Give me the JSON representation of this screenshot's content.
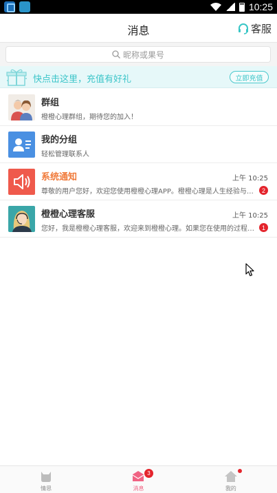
{
  "status_bar": {
    "time": "10:25"
  },
  "header": {
    "title": "消息",
    "service_label": "客服"
  },
  "search": {
    "placeholder": "昵称或果号"
  },
  "banner": {
    "text": "快点击这里，充值有好礼",
    "button_label": "立即充值"
  },
  "list": [
    {
      "title": "群组",
      "subtitle": "橙橙心理群组，期待您的加入！",
      "time": "",
      "badge": ""
    },
    {
      "title": "我的分组",
      "subtitle": "轻松管理联系人",
      "time": "",
      "badge": ""
    },
    {
      "title": "系统通知",
      "subtitle": "尊敬的用户您好，欢迎您使用橙橙心理APP。橙橙心理是人生经验与…",
      "time": "上午 10:25",
      "badge": "2"
    },
    {
      "title": "橙橙心理客服",
      "subtitle": "您好，我是橙橙心理客服，欢迎来到橙橙心理。如果您在使用的过程…",
      "time": "上午 10:25",
      "badge": "1"
    }
  ],
  "bottom_nav": {
    "items": [
      {
        "label": "情思",
        "icon": "cat-icon"
      },
      {
        "label": "消息",
        "icon": "envelope-icon",
        "badge": "3"
      },
      {
        "label": "我的",
        "icon": "house-icon"
      }
    ]
  },
  "colors": {
    "accent": "#3cc5c9",
    "notice": "#f07a3a",
    "active_tab": "#f06383",
    "badge": "#e4242c"
  }
}
